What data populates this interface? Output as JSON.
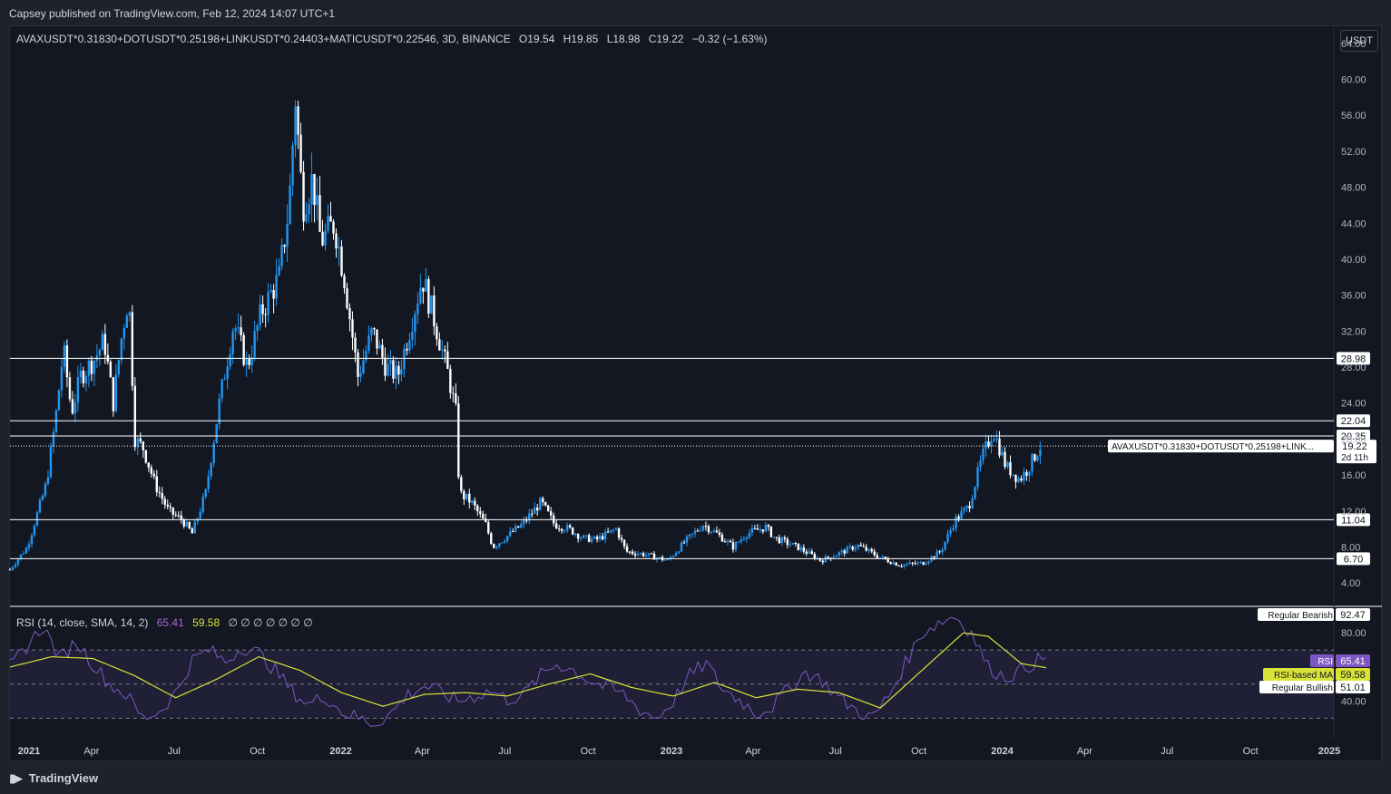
{
  "header": {
    "published": "Capsey published on TradingView.com, Feb 12, 2024 14:07 UTC+1"
  },
  "legend": {
    "symbol": "AVAXUSDT*0.31830+DOTUSDT*0.25198+LINKUSDT*0.24403+MATICUSDT*0.22546, 3D, BINANCE",
    "open": "O19.54",
    "high": "H19.85",
    "low": "L18.98",
    "close": "C19.22",
    "change": "−0.32 (−1.63%)"
  },
  "currency_button": "USDT",
  "price_tag": {
    "symbol_label": "AVAXUSDT*0.31830+DOTUSDT*0.25198+LINK...",
    "price": "19.22",
    "countdown": "2d 11h"
  },
  "rsi_legend": {
    "title": "RSI (14, close, SMA, 14, 2)",
    "rsi_value": "65.41",
    "ma_value": "59.58",
    "symbols": "∅ ∅ ∅ ∅ ∅ ∅ ∅"
  },
  "rsi_tags": {
    "bearish_label": "Regular Bearish",
    "bearish_value": "92.47",
    "rsi_label": "RSI",
    "rsi_value": "65.41",
    "ma_label": "RSI-based MA",
    "ma_value": "59.58",
    "bullish_label": "Regular Bullish",
    "bullish_value": "51.01"
  },
  "footer": {
    "brand": "TradingView"
  },
  "colors": {
    "background": "#131722",
    "candle_up": "#2196f3",
    "candle_down": "#ffffff",
    "rsi_line": "#7e57c2",
    "rsi_ma": "#d9e236",
    "level_line": "#ffffff"
  },
  "chart_data": [
    {
      "type": "candlestick",
      "title": "",
      "x_ticks": [
        "2021",
        "Apr",
        "Jul",
        "Oct",
        "2022",
        "Apr",
        "Jul",
        "Oct",
        "2023",
        "Apr",
        "Jul",
        "Oct",
        "2024",
        "Apr",
        "Jul",
        "Oct",
        "2025"
      ],
      "y_ticks": [
        "64.00",
        "60.00",
        "56.00",
        "52.00",
        "48.00",
        "44.00",
        "40.00",
        "36.00",
        "32.00",
        "28.00",
        "24.00",
        "20.00",
        "16.00",
        "12.00",
        "8.00",
        "4.00"
      ],
      "ylim": [
        1.5,
        66
      ],
      "horizontal_levels": [
        {
          "value": 28.98,
          "label": "28.98"
        },
        {
          "value": 22.04,
          "label": "22.04"
        },
        {
          "value": 20.35,
          "label": "20.35"
        },
        {
          "value": 11.04,
          "label": "11.04"
        },
        {
          "value": 6.7,
          "label": "6.70"
        }
      ],
      "last_price": 19.22,
      "x_range": [
        "2021-01-01",
        "2025-01-01"
      ],
      "series": [
        {
          "values": [
            [
              "2021-01-01",
              5.5
            ],
            [
              "2021-01-20",
              8.0
            ],
            [
              "2021-02-10",
              15.0
            ],
            [
              "2021-02-20",
              22.0
            ],
            [
              "2021-03-01",
              30.0
            ],
            [
              "2021-03-10",
              23.0
            ],
            [
              "2021-03-20",
              27.0
            ],
            [
              "2021-04-05",
              29.0
            ],
            [
              "2021-04-15",
              31.0
            ],
            [
              "2021-04-25",
              24.0
            ],
            [
              "2021-05-05",
              32.0
            ],
            [
              "2021-05-12",
              36.0
            ],
            [
              "2021-05-19",
              20.0
            ],
            [
              "2021-05-28",
              19.0
            ],
            [
              "2021-06-10",
              15.0
            ],
            [
              "2021-06-25",
              12.0
            ],
            [
              "2021-07-10",
              11.0
            ],
            [
              "2021-07-21",
              9.5
            ],
            [
              "2021-08-05",
              14.0
            ],
            [
              "2021-08-20",
              24.0
            ],
            [
              "2021-09-05",
              33.0
            ],
            [
              "2021-09-20",
              28.0
            ],
            [
              "2021-10-05",
              34.0
            ],
            [
              "2021-10-25",
              38.0
            ],
            [
              "2021-11-05",
              46.0
            ],
            [
              "2021-11-12",
              58.0
            ],
            [
              "2021-11-20",
              46.0
            ],
            [
              "2021-12-01",
              49.0
            ],
            [
              "2021-12-10",
              42.0
            ],
            [
              "2021-12-25",
              44.0
            ],
            [
              "2022-01-05",
              38.0
            ],
            [
              "2022-01-20",
              27.0
            ],
            [
              "2022-02-05",
              32.0
            ],
            [
              "2022-02-20",
              28.0
            ],
            [
              "2022-03-05",
              27.0
            ],
            [
              "2022-03-20",
              33.0
            ],
            [
              "2022-04-01",
              38.0
            ],
            [
              "2022-04-15",
              33.0
            ],
            [
              "2022-04-30",
              27.0
            ],
            [
              "2022-05-08",
              23.0
            ],
            [
              "2022-05-12",
              14.0
            ],
            [
              "2022-05-25",
              13.0
            ],
            [
              "2022-06-10",
              10.5
            ],
            [
              "2022-06-18",
              8.0
            ],
            [
              "2022-07-01",
              9.0
            ],
            [
              "2022-07-20",
              10.5
            ],
            [
              "2022-08-10",
              13.0
            ],
            [
              "2022-08-25",
              10.5
            ],
            [
              "2022-09-10",
              10.0
            ],
            [
              "2022-09-25",
              9.0
            ],
            [
              "2022-10-10",
              8.8
            ],
            [
              "2022-11-01",
              10.0
            ],
            [
              "2022-11-12",
              7.5
            ],
            [
              "2022-12-01",
              7.2
            ],
            [
              "2022-12-28",
              6.5
            ],
            [
              "2023-01-15",
              8.5
            ],
            [
              "2023-02-05",
              10.5
            ],
            [
              "2023-02-20",
              9.5
            ],
            [
              "2023-03-10",
              8.0
            ],
            [
              "2023-03-25",
              9.5
            ],
            [
              "2023-04-15",
              10.2
            ],
            [
              "2023-04-25",
              9.0
            ],
            [
              "2023-05-20",
              8.0
            ],
            [
              "2023-06-15",
              6.5
            ],
            [
              "2023-07-10",
              7.5
            ],
            [
              "2023-07-25",
              8.2
            ],
            [
              "2023-08-20",
              6.8
            ],
            [
              "2023-09-10",
              6.0
            ],
            [
              "2023-10-05",
              6.2
            ],
            [
              "2023-10-25",
              7.5
            ],
            [
              "2023-11-10",
              11.0
            ],
            [
              "2023-11-25",
              12.5
            ],
            [
              "2023-12-10",
              18.0
            ],
            [
              "2023-12-22",
              21.0
            ],
            [
              "2024-01-05",
              17.0
            ],
            [
              "2024-01-20",
              15.5
            ],
            [
              "2024-01-28",
              16.5
            ],
            [
              "2024-02-08",
              18.5
            ],
            [
              "2024-02-12",
              19.22
            ]
          ]
        }
      ]
    },
    {
      "type": "line",
      "title": "",
      "y_ticks": [
        "80.00",
        "40.00"
      ],
      "ylim": [
        18,
        95
      ],
      "bands": [
        70,
        50,
        30
      ],
      "series": [
        {
          "values": [
            [
              0,
              60
            ],
            [
              4,
              72
            ],
            [
              8,
              84
            ],
            [
              12,
              65
            ],
            [
              16,
              75
            ],
            [
              20,
              62
            ],
            [
              24,
              50
            ],
            [
              28,
              44
            ],
            [
              32,
              30
            ],
            [
              36,
              34
            ],
            [
              40,
              45
            ],
            [
              44,
              64
            ],
            [
              48,
              70
            ],
            [
              52,
              63
            ],
            [
              56,
              72
            ],
            [
              60,
              68
            ],
            [
              64,
              58
            ],
            [
              68,
              46
            ],
            [
              72,
              38
            ],
            [
              76,
              43
            ],
            [
              80,
              34
            ],
            [
              84,
              30
            ],
            [
              88,
              27
            ],
            [
              92,
              33
            ],
            [
              96,
              44
            ],
            [
              100,
              49
            ],
            [
              104,
              45
            ],
            [
              108,
              40
            ],
            [
              112,
              43
            ],
            [
              116,
              46
            ],
            [
              120,
              41
            ],
            [
              124,
              44
            ],
            [
              128,
              55
            ],
            [
              132,
              62
            ],
            [
              136,
              58
            ],
            [
              140,
              52
            ],
            [
              144,
              48
            ],
            [
              148,
              44
            ],
            [
              152,
              35
            ],
            [
              156,
              30
            ],
            [
              160,
              40
            ],
            [
              164,
              55
            ],
            [
              168,
              62
            ],
            [
              172,
              47
            ],
            [
              176,
              41
            ],
            [
              180,
              33
            ],
            [
              184,
              37
            ],
            [
              188,
              48
            ],
            [
              192,
              57
            ],
            [
              196,
              52
            ],
            [
              200,
              42
            ],
            [
              204,
              35
            ],
            [
              208,
              30
            ],
            [
              212,
              43
            ],
            [
              216,
              62
            ],
            [
              220,
              80
            ],
            [
              224,
              86
            ],
            [
              228,
              90
            ],
            [
              232,
              80
            ],
            [
              236,
              60
            ],
            [
              240,
              54
            ],
            [
              244,
              58
            ],
            [
              248,
              64
            ],
            [
              250,
              65.41
            ]
          ]
        },
        {
          "values": [
            [
              0,
              60
            ],
            [
              10,
              66
            ],
            [
              20,
              65
            ],
            [
              30,
              55
            ],
            [
              40,
              42
            ],
            [
              50,
              53
            ],
            [
              60,
              66
            ],
            [
              70,
              58
            ],
            [
              80,
              45
            ],
            [
              90,
              37
            ],
            [
              100,
              44
            ],
            [
              110,
              45
            ],
            [
              120,
              43
            ],
            [
              130,
              50
            ],
            [
              140,
              56
            ],
            [
              150,
              48
            ],
            [
              160,
              43
            ],
            [
              170,
              51
            ],
            [
              180,
              42
            ],
            [
              190,
              47
            ],
            [
              200,
              45
            ],
            [
              210,
              36
            ],
            [
              220,
              58
            ],
            [
              230,
              80
            ],
            [
              236,
              78
            ],
            [
              244,
              62
            ],
            [
              250,
              59.58
            ]
          ]
        }
      ]
    }
  ]
}
